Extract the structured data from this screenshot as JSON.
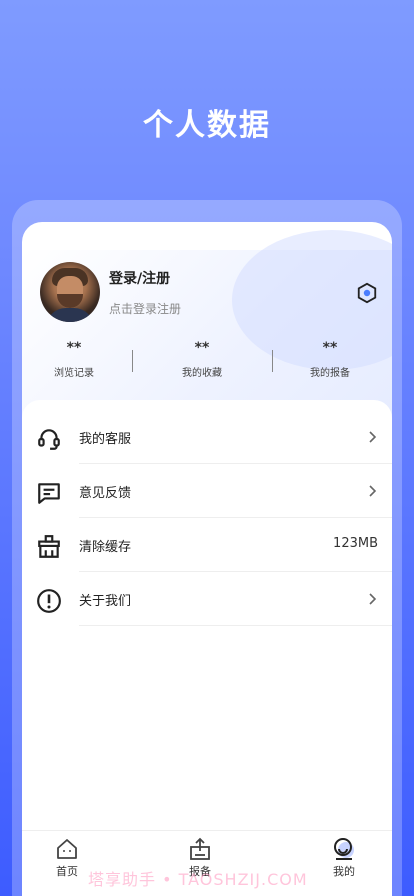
{
  "hero": {
    "title": "个人数据"
  },
  "profile": {
    "login_title": "登录/注册",
    "login_sub": "点击登录注册"
  },
  "stats": [
    {
      "value": "**",
      "label": "浏览记录"
    },
    {
      "value": "**",
      "label": "我的收藏"
    },
    {
      "value": "**",
      "label": "我的报备"
    }
  ],
  "menu": [
    {
      "label": "我的客服",
      "icon": "headset-icon"
    },
    {
      "label": "意见反馈",
      "icon": "feedback-icon"
    },
    {
      "label": "清除缓存",
      "icon": "clear-cache-icon",
      "value": "123MB"
    },
    {
      "label": "关于我们",
      "icon": "info-icon"
    }
  ],
  "tabs": [
    {
      "label": "首页",
      "icon": "home-icon"
    },
    {
      "label": "报备",
      "icon": "report-icon"
    },
    {
      "label": "我的",
      "icon": "profile-icon",
      "active": true
    }
  ],
  "watermark": "塔享助手 • TAOSHZIJ.COM",
  "colors": {
    "accent": "#3d5cff",
    "settings_accent": "#4a7dff"
  }
}
